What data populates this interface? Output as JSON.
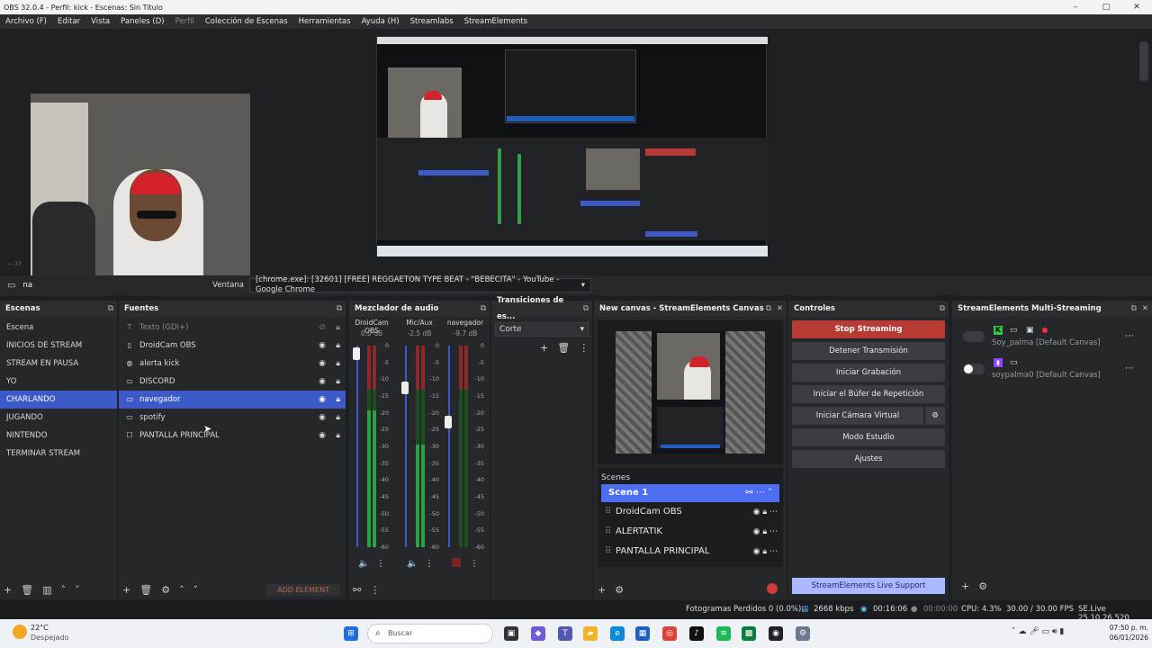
{
  "titlebar": {
    "title": "OBS 32.0.4 - Perfil: kick - Escenas: Sin Titulo",
    "min": "–",
    "max": "□",
    "close": "✕"
  },
  "menu": [
    "Archivo (F)",
    "Editar",
    "Vista",
    "Paneles (D)",
    "Perfil",
    "Colección de Escenas",
    "Herramientas",
    "Ayuda (H)",
    "Streamlabs",
    "StreamElements"
  ],
  "sourcebar": {
    "source_name": "na",
    "label": "Ventana",
    "value": "[chrome.exe]: [32601] [FREE] REGGAETON TYPE BEAT - \"BEBECITA\" - YouTube - Google Chrome"
  },
  "scenes": {
    "title": "Escenas",
    "items": [
      "Escena",
      "INICIOS DE STREAM",
      "STREAM EN PAUSA",
      "YO",
      "CHARLANDO",
      "JUGANDO",
      "NINTENDO",
      "TERMINAR STREAM"
    ],
    "selected_index": 4
  },
  "sources": {
    "title": "Fuentes",
    "items": [
      {
        "name": "Texto (GDI+)",
        "icon": "text-icon",
        "dim": true
      },
      {
        "name": "DroidCam OBS",
        "icon": "window-icon"
      },
      {
        "name": "alerta kick",
        "icon": "globe-icon"
      },
      {
        "name": "DISCORD",
        "icon": "window-icon"
      },
      {
        "name": "navegador",
        "icon": "monitor-icon",
        "selected": true
      },
      {
        "name": "spotify",
        "icon": "monitor-icon"
      },
      {
        "name": "PANTALLA PRINCIPAL",
        "icon": "display-icon"
      }
    ],
    "add_element": "ADD ELEMENT"
  },
  "mixer": {
    "title": "Mezclador de audio",
    "channels": [
      {
        "name": "DroidCam OBS",
        "db": "0.0 dB",
        "level": 0.8
      },
      {
        "name": "Mic/Aux",
        "db": "-2.5 dB",
        "level": 0.6
      },
      {
        "name": "navegador",
        "db": "-9.7 dB",
        "level": 0.0
      }
    ],
    "scale": [
      "0",
      "-5",
      "-10",
      "-15",
      "-20",
      "-25",
      "-30",
      "-35",
      "-40",
      "-45",
      "-50",
      "-55",
      "-60"
    ]
  },
  "transitions": {
    "title": "Transiciones de es...",
    "value": "Corte"
  },
  "canvas": {
    "title": "New canvas - StreamElements Canvas",
    "scenes_label": "Scenes",
    "scene": "Scene 1",
    "items": [
      "DroidCam OBS",
      "ALERTATIK",
      "PANTALLA PRINCIPAL"
    ]
  },
  "controls": {
    "title": "Controles",
    "buttons": [
      "Stop Streaming",
      "Detener Transmisión",
      "Iniciar Grabación",
      "Iniciar el Búfer de Repetición",
      "Iniciar Cámara Virtual",
      "Modo Estudio",
      "Ajustes"
    ],
    "support": "StreamElements Live Support"
  },
  "multistream": {
    "title": "StreamElements Multi-Streaming",
    "targets": [
      {
        "name": "Soy_palma [Default Canvas]",
        "platform": "kick-icon"
      },
      {
        "name": "soypalma0 [Default Canvas]",
        "platform": "twitch-icon"
      }
    ]
  },
  "status": {
    "dropped": "Fotogramas Perdidos 0 (0.0%)",
    "bitrate": "2668 kbps",
    "stream_time": "00:16:06",
    "rec_time": "00:00:00",
    "cpu": "CPU: 4.3%",
    "fps": "30.00 / 30.00 FPS",
    "version": "SE.Live 25.10.26.520"
  },
  "taskbar": {
    "temp": "22°C",
    "weather": "Despejado",
    "search": "Buscar",
    "time": "07:50 p. m.",
    "date": "06/01/2026"
  },
  "colors": {
    "accent": "#3d59c7",
    "stop": "#b73a33",
    "support": "#a9b8ff"
  }
}
